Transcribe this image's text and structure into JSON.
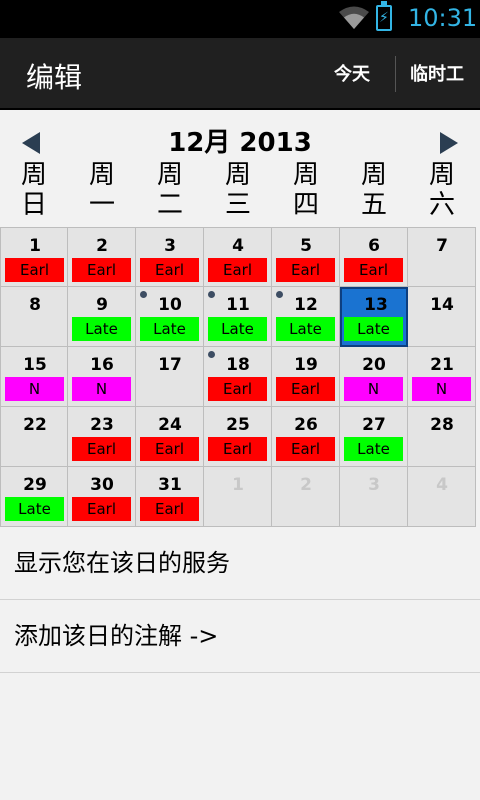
{
  "status_bar": {
    "time": "10:31"
  },
  "action_bar": {
    "title": "编辑",
    "today_label": "今天",
    "temp_label": "临时工"
  },
  "calendar": {
    "month_title": "12月 2013",
    "weekdays": [
      "周\n日",
      "周\n一",
      "周\n二",
      "周\n三",
      "周\n四",
      "周\n五",
      "周\n六"
    ],
    "shift_colors": {
      "Earl": "#ff0000",
      "Late": "#00ff00",
      "N": "#ff00ff"
    },
    "selected_day": "13",
    "cells": [
      {
        "day": "1",
        "shift": "Earl"
      },
      {
        "day": "2",
        "shift": "Earl"
      },
      {
        "day": "3",
        "shift": "Earl"
      },
      {
        "day": "4",
        "shift": "Earl"
      },
      {
        "day": "5",
        "shift": "Earl"
      },
      {
        "day": "6",
        "shift": "Earl"
      },
      {
        "day": "7",
        "shift": ""
      },
      {
        "day": "8",
        "shift": ""
      },
      {
        "day": "9",
        "shift": "Late"
      },
      {
        "day": "10",
        "shift": "Late",
        "dot": true
      },
      {
        "day": "11",
        "shift": "Late",
        "dot": true
      },
      {
        "day": "12",
        "shift": "Late",
        "dot": true
      },
      {
        "day": "13",
        "shift": "Late"
      },
      {
        "day": "14",
        "shift": ""
      },
      {
        "day": "15",
        "shift": "N"
      },
      {
        "day": "16",
        "shift": "N"
      },
      {
        "day": "17",
        "shift": ""
      },
      {
        "day": "18",
        "shift": "Earl",
        "dot": true
      },
      {
        "day": "19",
        "shift": "Earl"
      },
      {
        "day": "20",
        "shift": "N"
      },
      {
        "day": "21",
        "shift": "N"
      },
      {
        "day": "22",
        "shift": ""
      },
      {
        "day": "23",
        "shift": "Earl"
      },
      {
        "day": "24",
        "shift": "Earl"
      },
      {
        "day": "25",
        "shift": "Earl"
      },
      {
        "day": "26",
        "shift": "Earl"
      },
      {
        "day": "27",
        "shift": "Late"
      },
      {
        "day": "28",
        "shift": ""
      },
      {
        "day": "29",
        "shift": "Late"
      },
      {
        "day": "30",
        "shift": "Earl"
      },
      {
        "day": "31",
        "shift": "Earl"
      },
      {
        "day": "1",
        "shift": "",
        "other_month": true
      },
      {
        "day": "2",
        "shift": "",
        "other_month": true
      },
      {
        "day": "3",
        "shift": "",
        "other_month": true
      },
      {
        "day": "4",
        "shift": "",
        "other_month": true
      }
    ]
  },
  "list": {
    "show_service": "显示您在该日的服务",
    "add_note": "添加该日的注解 ->"
  }
}
